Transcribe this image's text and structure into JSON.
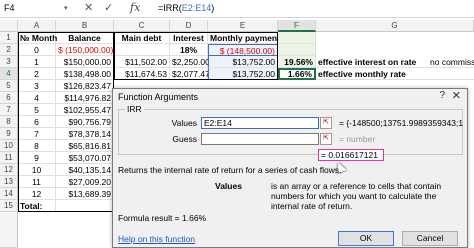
{
  "formula_bar": {
    "name_box": "F4",
    "cancel_icon": "✕",
    "enter_icon": "✓",
    "fx_label": "fx",
    "formula_prefix": "=IRR(",
    "formula_ref": "E2:E14",
    "formula_suffix": ")"
  },
  "columns": [
    "A",
    "B",
    "C",
    "D",
    "E",
    "F",
    "G"
  ],
  "rows": [
    "1",
    "2",
    "3",
    "4",
    "5",
    "6",
    "7",
    "8",
    "9",
    "10",
    "11",
    "12",
    "13",
    "14",
    "15"
  ],
  "headers": {
    "a": "№ Month",
    "b": "Balance",
    "c": "Main debt",
    "d": "Interest",
    "e": "Monthly payment"
  },
  "data": {
    "r2": {
      "a": "0",
      "b": "$ (150,000.00)",
      "d": "18%",
      "e": "$ (148,500.00)"
    },
    "r3": {
      "a": "1",
      "b": "$150,000.00",
      "c": "$11,502.00",
      "d": "$2,250.00",
      "e": "$13,752.00",
      "f": "19.56%",
      "g": "effective interest on rate",
      "h": "no commissions"
    },
    "r4": {
      "a": "2",
      "b": "$138,498.00",
      "c": "$11,674.53",
      "d": "$2,077.47",
      "e": "$13,752.00",
      "f": "1.66%",
      "g": "effective monthly rate"
    },
    "r5": {
      "a": "3",
      "b": "$126,823.47"
    },
    "r6": {
      "a": "4",
      "b": "$114,976.82"
    },
    "r7": {
      "a": "5",
      "b": "$102,955.47"
    },
    "r8": {
      "a": "6",
      "b": "$90,756.79"
    },
    "r9": {
      "a": "7",
      "b": "$78,378.14"
    },
    "r10": {
      "a": "8",
      "b": "$65,816.81"
    },
    "r11": {
      "a": "9",
      "b": "$53,070.07"
    },
    "r12": {
      "a": "10",
      "b": "$40,135.14"
    },
    "r13": {
      "a": "11",
      "b": "$27,009.20"
    },
    "r14": {
      "a": "12",
      "b": "$13,689.39"
    },
    "r15": {
      "a": "Total:"
    }
  },
  "dialog": {
    "title": "Function Arguments",
    "help_icon": "?",
    "close_icon": "✕",
    "group_label": "IRR",
    "values_label": "Values",
    "values_input": "E2:E14",
    "values_result": "= {-148500;13751.9989359343;13751.9...",
    "guess_label": "Guess",
    "guess_input": "",
    "guess_result": "= number",
    "result_value": "= 0.016617121",
    "description": "Returns the internal rate of return for a series of cash flows.",
    "arg_name": "Values",
    "arg_description": "is an array or a reference to cells that contain numbers for which you want to calculate the internal rate of return.",
    "formula_result": "Formula result =   1.66%",
    "help_link": "Help on this function",
    "ok_label": "OK",
    "cancel_label": "Cancel"
  }
}
